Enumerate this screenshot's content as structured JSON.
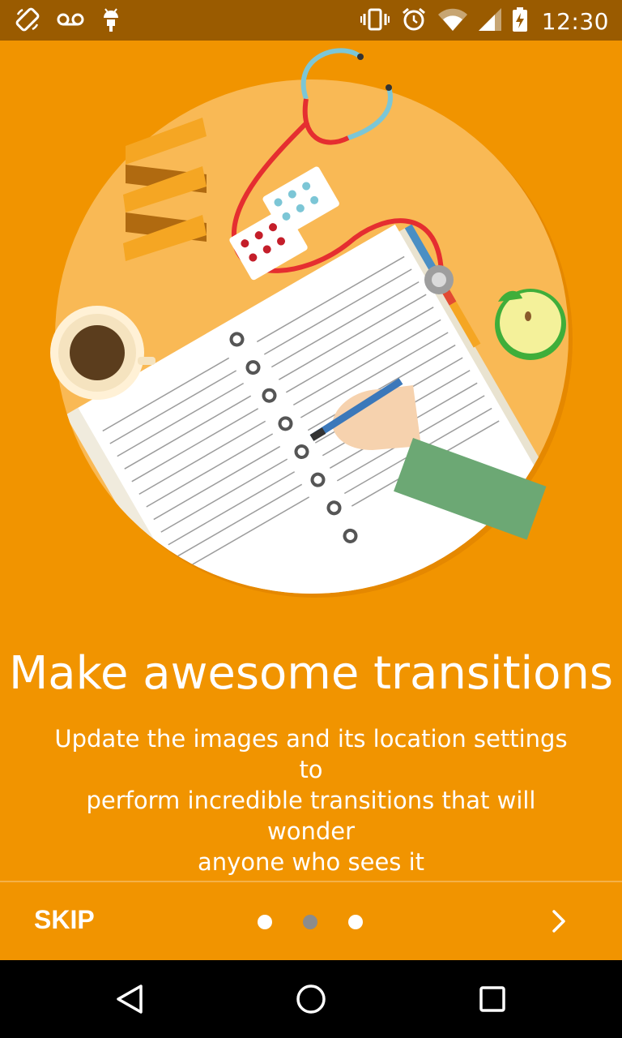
{
  "status_bar": {
    "time": "12:30",
    "icons_left": [
      "screen-rotation-icon",
      "voicemail-icon",
      "android-debug-icon"
    ],
    "icons_right": [
      "vibrate-icon",
      "alarm-icon",
      "wifi-icon",
      "cell-signal-icon",
      "battery-charging-icon"
    ]
  },
  "onboarding": {
    "illustration_icon": "medical-notebook-illustration",
    "title": "Make awesome transitions",
    "subtitle_lines": [
      "Update the images and its location settings to",
      "perform incredible transitions that will wonder",
      "anyone who sees it"
    ]
  },
  "footer": {
    "skip_label": "SKIP",
    "page_count": 3,
    "active_page": 2,
    "next_icon": "chevron-right-icon"
  },
  "nav_bar": {
    "back_icon": "back-triangle-icon",
    "home_icon": "home-circle-icon",
    "recents_icon": "recents-square-icon"
  },
  "colors": {
    "background": "#F19400",
    "status_bar": "#9A5B00",
    "nav_bar": "#000000",
    "active_dot": "#8C8C8C",
    "inactive_dot": "#FFFFFF"
  }
}
